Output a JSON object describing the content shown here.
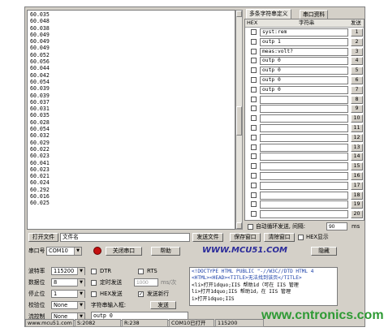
{
  "log": {
    "lines": [
      "60.035",
      "60.048",
      "60.038",
      "60.049",
      "60.049",
      "60.049",
      "60.052",
      "60.056",
      "60.044",
      "60.042",
      "60.054",
      "60.039",
      "60.039",
      "60.037",
      "60.031",
      "60.035",
      "60.028",
      "60.054",
      "60.032",
      "60.029",
      "60.022",
      "60.023",
      "60.041",
      "60.023",
      "60.021",
      "60.024",
      "60.292",
      "60.016",
      "60.025"
    ]
  },
  "multi": {
    "tab_multi": "多条字符串定义",
    "tab_serial": "串口资料",
    "col_hex": "HEX",
    "col_string": "字符串",
    "col_send": "发送",
    "rows": [
      {
        "text": "syst:rem",
        "num": "1"
      },
      {
        "text": "outp 1",
        "num": "2"
      },
      {
        "text": "meas:volt?",
        "num": "3"
      },
      {
        "text": "outp 0",
        "num": "4"
      },
      {
        "text": "outp 0",
        "num": "5"
      },
      {
        "text": "outp 0",
        "num": "6"
      },
      {
        "text": "outp 0",
        "num": "7"
      },
      {
        "text": "",
        "num": "8"
      },
      {
        "text": "",
        "num": "9"
      },
      {
        "text": "",
        "num": "10"
      },
      {
        "text": "",
        "num": "11"
      },
      {
        "text": "",
        "num": "12"
      },
      {
        "text": "",
        "num": "13"
      },
      {
        "text": "",
        "num": "14"
      },
      {
        "text": "",
        "num": "15"
      },
      {
        "text": "",
        "num": "16"
      },
      {
        "text": "",
        "num": "17"
      },
      {
        "text": "",
        "num": "18"
      },
      {
        "text": "",
        "num": "19"
      },
      {
        "text": "",
        "num": "20"
      }
    ],
    "loop_label": "自动循环发送, 间隔:",
    "loop_interval": "90",
    "loop_unit": "ms"
  },
  "file_row": {
    "open_file": "打开文件",
    "filename": "文件名",
    "send_file": "发送文件",
    "save_window": "保存窗口",
    "clear_window": "清除窗口",
    "hex_display": "HEX显示"
  },
  "port_row": {
    "port_label": "串口号",
    "port_value": "COM10",
    "close_port": "关闭串口",
    "help": "帮助",
    "logo": "WWW.MCU51.COM",
    "hide": "隐藏"
  },
  "settings": {
    "baud_label": "波特率",
    "baud_value": "115200",
    "data_label": "数据位",
    "data_value": "8",
    "stop_label": "停止位",
    "stop_value": "1",
    "parity_label": "校验位",
    "parity_value": "None",
    "flow_label": "流控制",
    "flow_value": "None",
    "dtr": "DTR",
    "rts": "RTS",
    "timed_send": "定时发送",
    "timed_value": "1000",
    "timed_unit": "ms/次",
    "hex_send": "HEX发送",
    "send_newline": "发送新行",
    "input_label": "字符串输入框:",
    "send_button": "发送",
    "input_value": "outp 0"
  },
  "html_box": {
    "lines": [
      "<!DOCTYPE HTML PUBLIC \"-//W3C//DTD HTML 4",
      "<HTML><HEAD><TITLE>无法找到该页</TITLE>",
      "<li>打开1dquo;IIS 帮助1d（可在 IIS 管理",
      "li>打开1dquo;IIS 帮助1d，在 IIS 管理",
      "i>打开1dquo;IIS"
    ]
  },
  "status": {
    "site": "www.mcu51.com",
    "sent": "S:2082",
    "received": "R:238",
    "port_state": "COM10已打开",
    "port_info": "115200"
  },
  "watermark": "www.cntronics.com"
}
